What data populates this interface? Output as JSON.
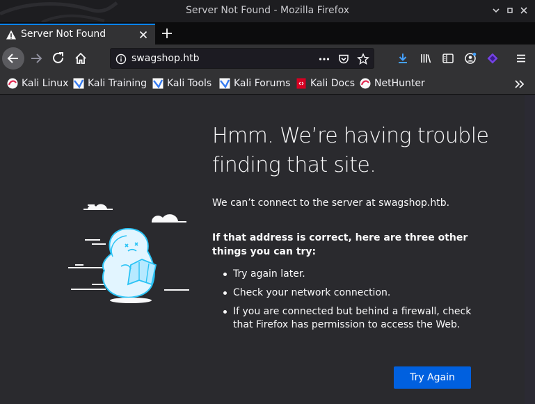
{
  "window": {
    "title": "Server Not Found - Mozilla Firefox",
    "controls": {
      "minimize": "⌄",
      "maximize": "▫",
      "close": "✕"
    }
  },
  "tabs": [
    {
      "label": "Server Not Found",
      "icon": "warning-icon",
      "active": true
    }
  ],
  "navbar": {
    "url": "swagshop.htb",
    "icons": [
      "back-arrow-icon",
      "forward-arrow-icon",
      "reload-icon",
      "home-icon",
      "info-icon",
      "page-actions-icon",
      "pocket-icon",
      "bookmark-star-icon",
      "download-icon",
      "library-icon",
      "sidebar-icon",
      "account-icon",
      "extension-icon",
      "menu-icon"
    ]
  },
  "bookmarks": [
    {
      "label": "Kali Linux",
      "icon": "kali-linux-icon"
    },
    {
      "label": "Kali Training",
      "icon": "kali-training-icon"
    },
    {
      "label": "Kali Tools",
      "icon": "kali-tools-icon"
    },
    {
      "label": "Kali Forums",
      "icon": "kali-forums-icon"
    },
    {
      "label": "Kali Docs",
      "icon": "kali-docs-icon"
    },
    {
      "label": "NetHunter",
      "icon": "nethunter-icon"
    }
  ],
  "error_page": {
    "heading": "Hmm. We’re having trouble finding that site.",
    "cant_connect": "We can’t connect to the server at swagshop.htb.",
    "suggest_title": "If that address is correct, here are three other things you can try:",
    "suggestions": [
      "Try again later.",
      "Check your network connection.",
      "If you are connected but behind a firewall, check that Firefox has permission to access the Web."
    ],
    "try_again_label": "Try Again"
  },
  "colors": {
    "accent": "#0a84ff",
    "button": "#0060df",
    "background": "#2a2a2e",
    "toolbar": "#323234"
  }
}
